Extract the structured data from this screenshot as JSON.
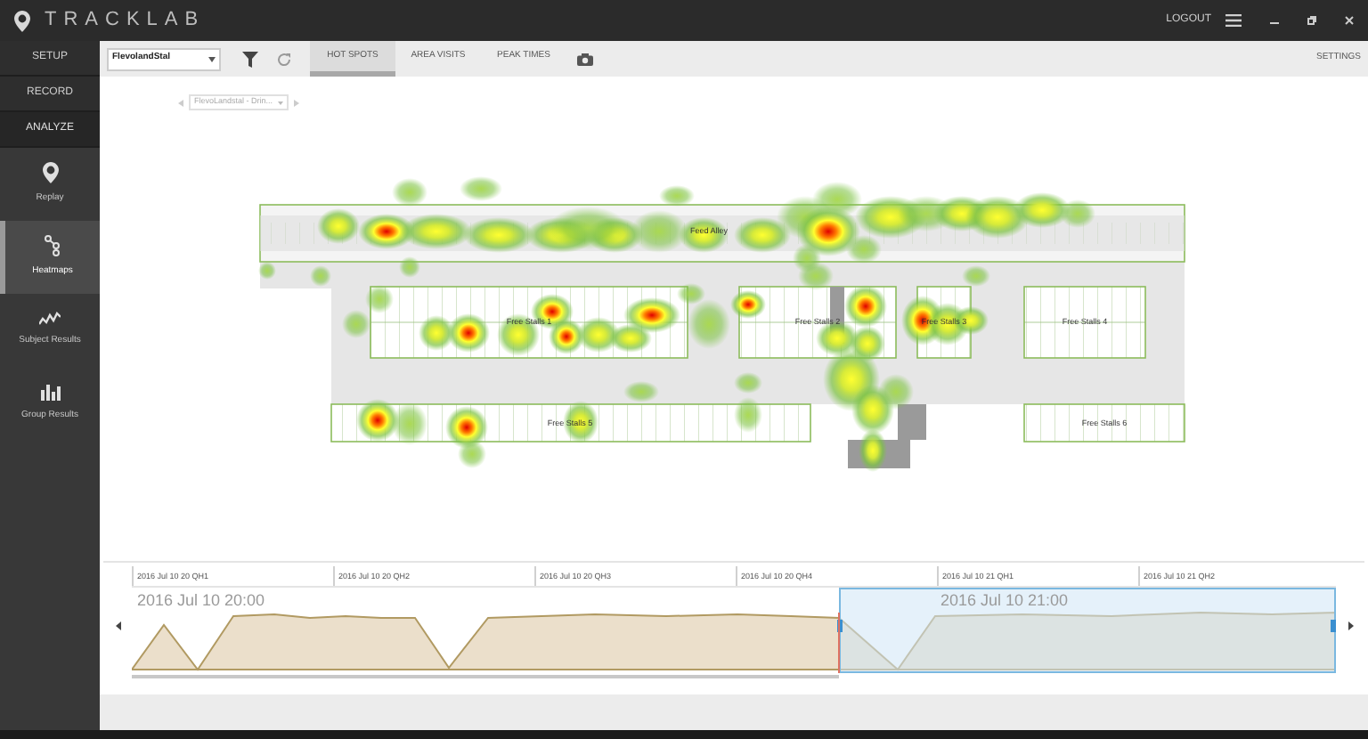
{
  "app": {
    "title": "TRACKLAB",
    "logout": "LOGOUT"
  },
  "nav": [
    {
      "label": "SETUP",
      "selected": false
    },
    {
      "label": "RECORD",
      "selected": false
    },
    {
      "label": "ANALYZE",
      "selected": true
    }
  ],
  "analyze_items": [
    {
      "label": "Replay",
      "kind": "pin",
      "selected": false
    },
    {
      "label": "Heatmaps",
      "kind": "nodes",
      "selected": true
    },
    {
      "label": "Subject Results",
      "kind": "trend",
      "selected": false
    },
    {
      "label": "Group Results",
      "kind": "bars",
      "selected": false
    }
  ],
  "toolbar": {
    "dataset": "FlevolandStal",
    "tabs": [
      {
        "label": "HOT SPOTS",
        "selected": true
      },
      {
        "label": "AREA VISITS",
        "selected": false
      },
      {
        "label": "PEAK TIMES",
        "selected": false
      }
    ],
    "settings": "SETTINGS"
  },
  "view_selector": "FlevoLandstal - Drin...",
  "heatmap": {
    "areas": [
      {
        "label": "Feed Alley"
      },
      {
        "label": "Free Stalls 1"
      },
      {
        "label": "Free Stalls 2"
      },
      {
        "label": "Free Stalls 3"
      },
      {
        "label": "Free Stalls 4"
      },
      {
        "label": "Free Stalls 5"
      },
      {
        "label": "Free Stalls 6"
      }
    ]
  },
  "timeline": {
    "ticks": [
      "2016 Jul 10 20 QH1",
      "2016 Jul 10 20 QH2",
      "2016 Jul 10 20 QH3",
      "2016 Jul 10 20 QH4",
      "2016 Jul 10 21 QH1",
      "2016 Jul 10 21 QH2"
    ],
    "period_labels": [
      "2016 Jul 10 20:00",
      "2016 Jul 10 21:00"
    ]
  }
}
